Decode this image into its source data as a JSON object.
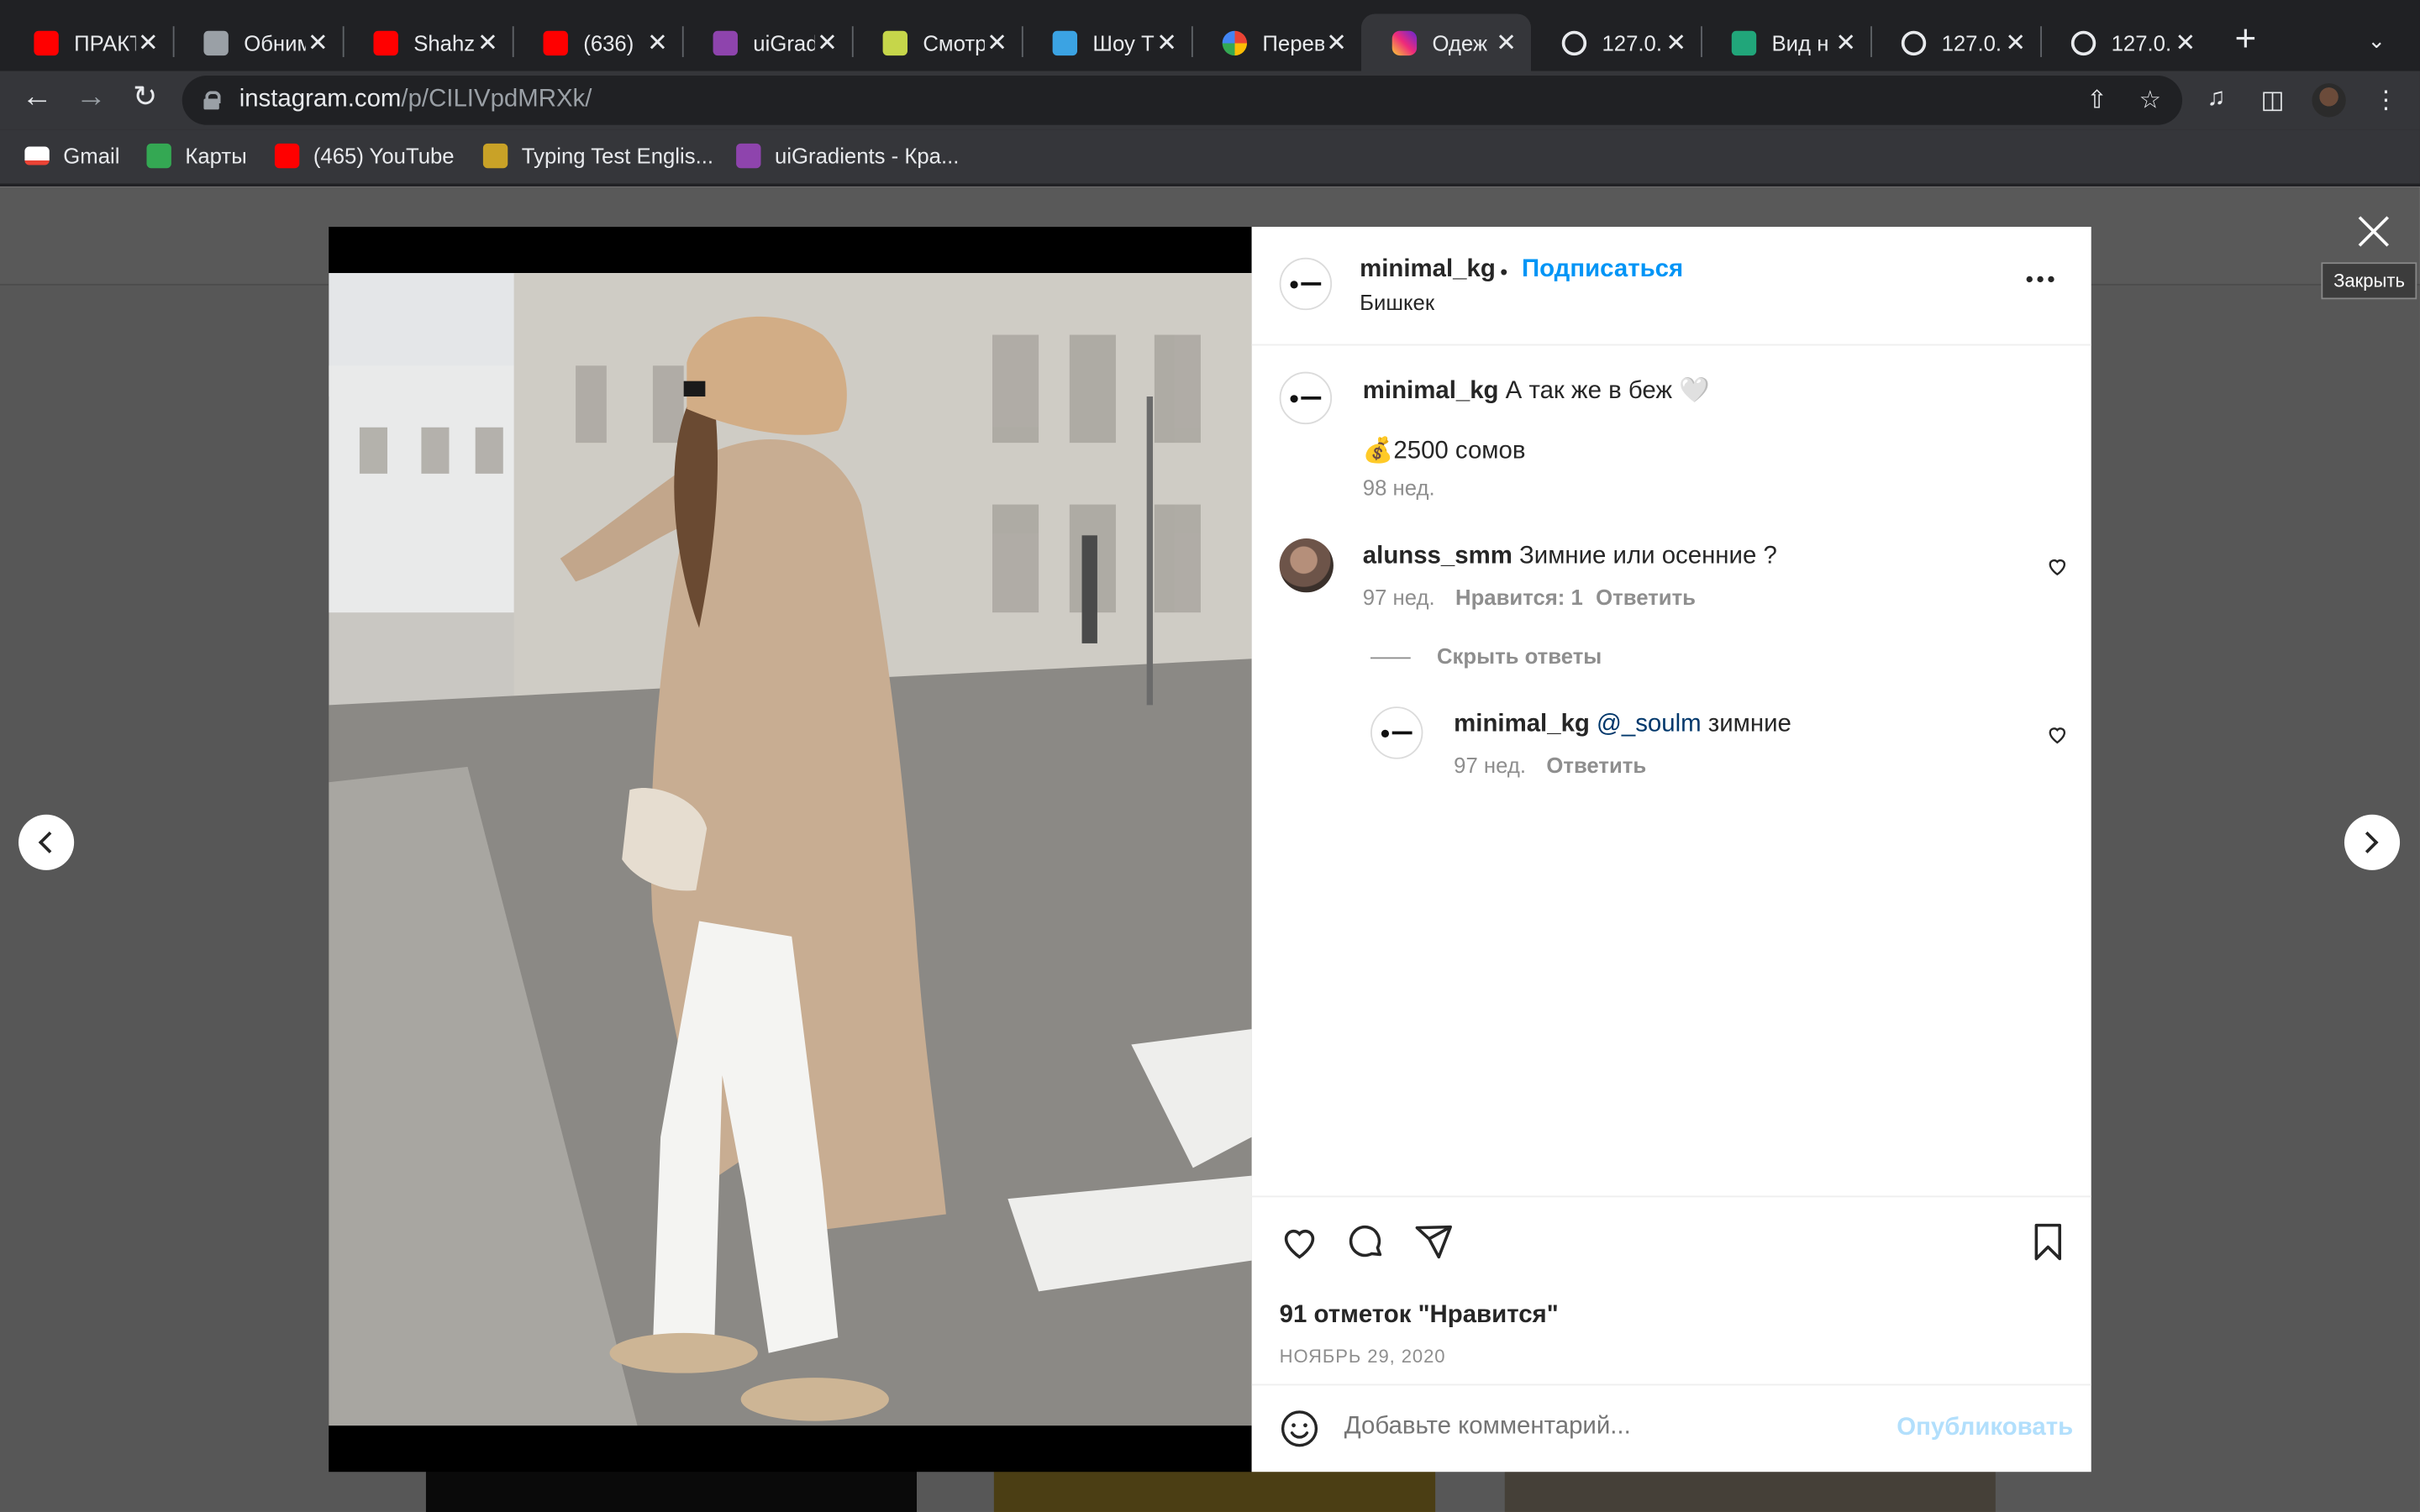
{
  "browser": {
    "tabs": [
      {
        "title": "ПРАКТ",
        "icon": "youtube-icon",
        "color": "#ff0000"
      },
      {
        "title": "Обним",
        "icon": "bookstack-icon",
        "color": "#9aa0a6"
      },
      {
        "title": "Shahz",
        "icon": "youtube-icon",
        "color": "#ff0000"
      },
      {
        "title": "(636)",
        "icon": "youtube-icon",
        "color": "#ff0000"
      },
      {
        "title": "uiGrad",
        "icon": "uigradients-icon",
        "color": "#8e44ad"
      },
      {
        "title": "Смотр",
        "icon": "site-icon",
        "color": "#c6d64a"
      },
      {
        "title": "Шоу Т",
        "icon": "site-icon",
        "color": "#3ba3e3"
      },
      {
        "title": "Перев",
        "icon": "google-icon",
        "color": "#4285f4"
      },
      {
        "title": "Одеж",
        "icon": "instagram-icon",
        "color": "#e1306c"
      },
      {
        "title": "127.0.",
        "icon": "globe-icon",
        "color": "#e8eaed"
      },
      {
        "title": "Вид н",
        "icon": "site-icon",
        "color": "#21a67a"
      },
      {
        "title": "127.0.",
        "icon": "globe-icon",
        "color": "#e8eaed"
      },
      {
        "title": "127.0.",
        "icon": "globe-icon",
        "color": "#e8eaed"
      }
    ],
    "active_tab_index": 8,
    "url_host": "instagram.com",
    "url_path": "/p/CILIVpdMRXk/",
    "bookmarks": [
      {
        "label": "Gmail",
        "icon": "gmail-icon",
        "color": "#ea4335"
      },
      {
        "label": "Карты",
        "icon": "maps-icon",
        "color": "#34a853"
      },
      {
        "label": "(465) YouTube",
        "icon": "youtube-icon",
        "color": "#ff0000"
      },
      {
        "label": "Typing Test Englis...",
        "icon": "site-icon",
        "color": "#c9a227"
      },
      {
        "label": "uiGradients - Кра...",
        "icon": "uigradients-icon",
        "color": "#8e44ad"
      }
    ]
  },
  "overlay": {
    "close_tooltip": "Закрыть"
  },
  "post": {
    "username": "minimal_kg",
    "follow_label": "Подписаться",
    "location": "Бишкек",
    "caption_text": "А так же в беж 🤍",
    "caption_price": "💰2500 сомов",
    "caption_time": "98 нед.",
    "comments": [
      {
        "username": "alunss_smm",
        "text": "Зимние или осенние ?",
        "time": "97 нед.",
        "likes": "Нравится: 1",
        "reply_label": "Ответить",
        "hide_replies_label": "Скрыть ответы",
        "replies": [
          {
            "username": "minimal_kg",
            "mention": "@_soulm",
            "text": "зимние",
            "time": "97 нед.",
            "reply_label": "Ответить"
          }
        ]
      }
    ],
    "likes_count": "91 отметок \"Нравится\"",
    "date": "НОЯБРЬ 29, 2020",
    "comment_placeholder": "Добавьте комментарий...",
    "publish_label": "Опубликовать"
  },
  "colors": {
    "link": "#0095f6",
    "text": "#262626",
    "muted": "#8e8e8e",
    "chrome": "#35363a"
  }
}
